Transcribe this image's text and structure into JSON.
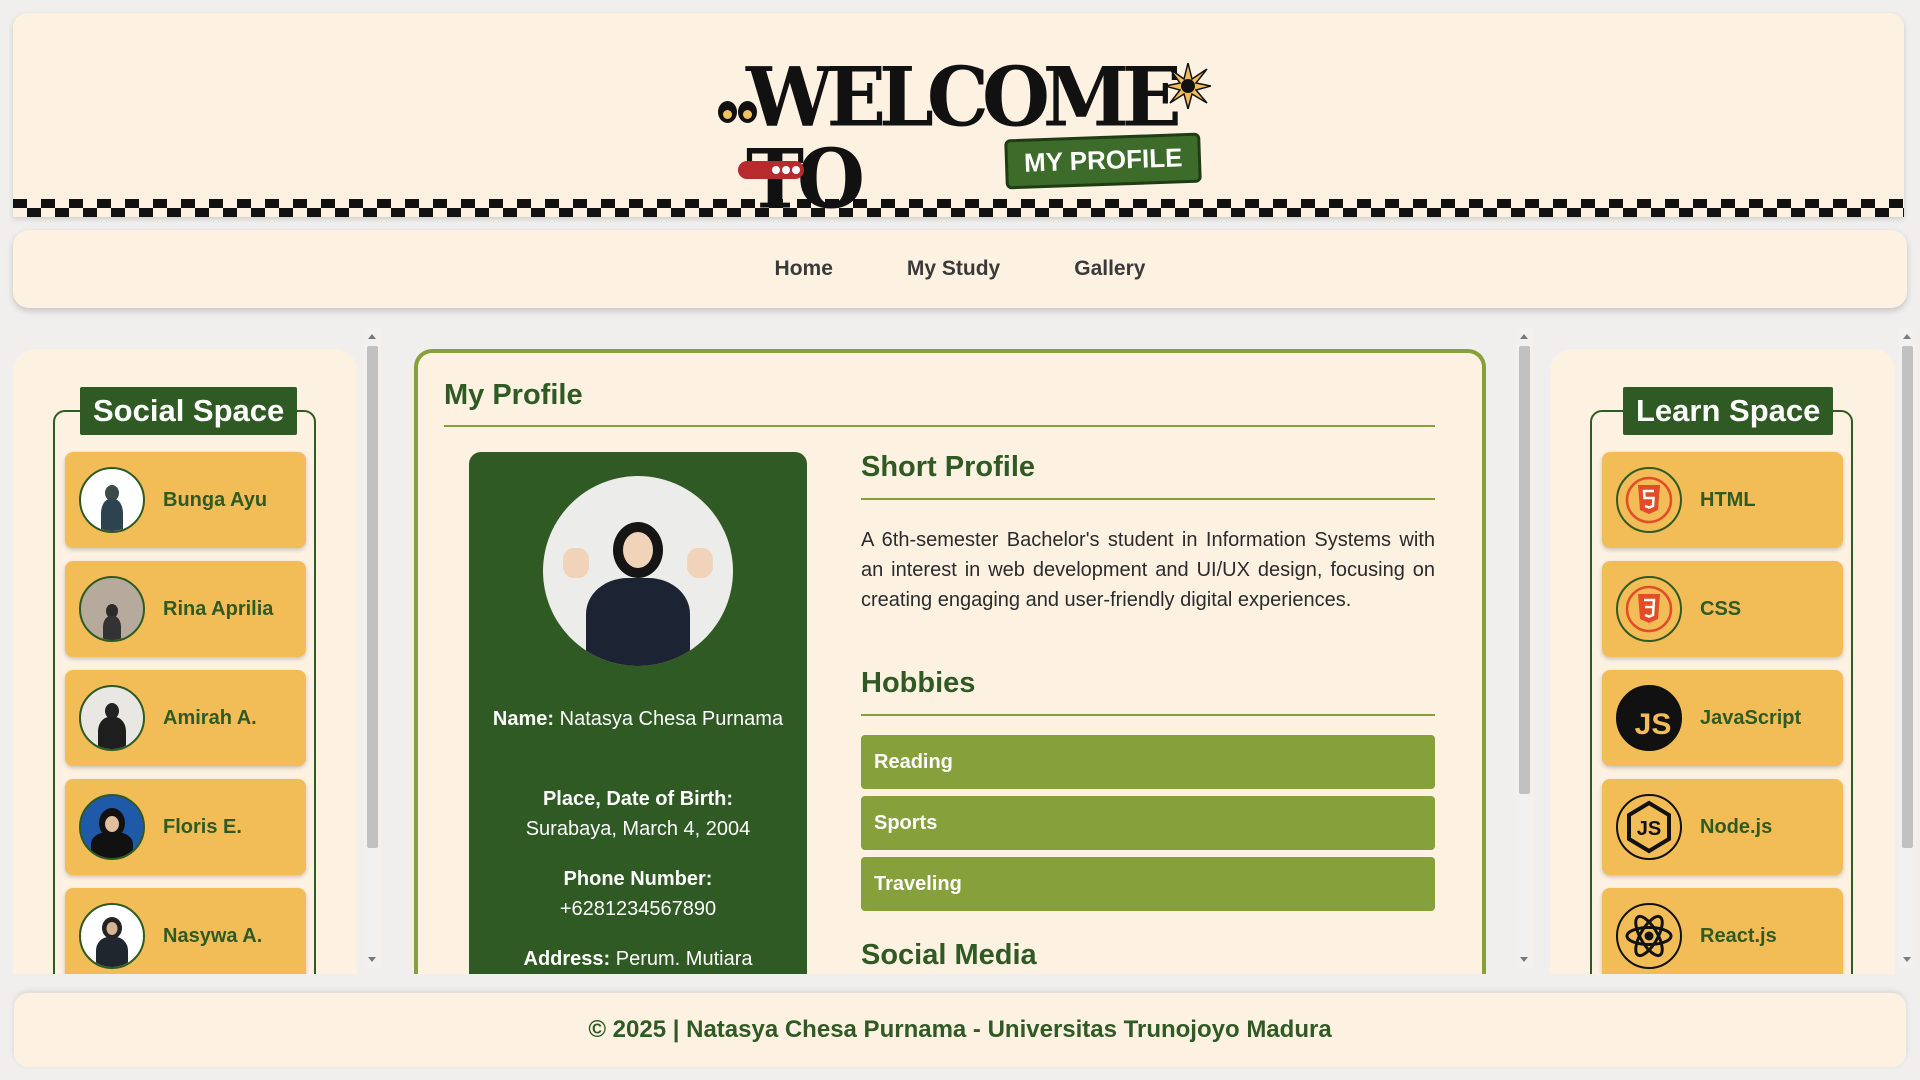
{
  "header": {
    "logo_text": "WELCOME TO",
    "logo_badge": "MY PROFILE"
  },
  "nav": {
    "items": [
      {
        "label": "Home"
      },
      {
        "label": "My Study"
      },
      {
        "label": "Gallery"
      }
    ]
  },
  "social_space": {
    "title": "Social Space",
    "friends": [
      {
        "name": "Bunga Ayu"
      },
      {
        "name": "Rina Aprilia"
      },
      {
        "name": "Amirah A."
      },
      {
        "name": "Floris E."
      },
      {
        "name": "Nasywa A."
      }
    ]
  },
  "learn_space": {
    "title": "Learn Space",
    "items": [
      {
        "name": "HTML",
        "icon": "html5-icon"
      },
      {
        "name": "CSS",
        "icon": "css3-icon"
      },
      {
        "name": "JavaScript",
        "icon": "javascript-icon"
      },
      {
        "name": "Node.js",
        "icon": "nodejs-icon"
      },
      {
        "name": "React.js",
        "icon": "react-icon"
      }
    ]
  },
  "main": {
    "title": "My Profile",
    "profile": {
      "name_label": "Name:",
      "name_value": "Natasya Chesa Purnama",
      "birth_label": "Place, Date of Birth:",
      "birth_value": "Surabaya, March 4, 2004",
      "phone_label": "Phone Number:",
      "phone_value": "+6281234567890",
      "address_label": "Address:",
      "address_value": "Perum. Mutiara"
    },
    "short_profile": {
      "title": "Short Profile",
      "text": "A 6th-semester Bachelor's student in Information Systems with an interest in web development and UI/UX design, focusing on creating engaging and user-friendly digital experiences."
    },
    "hobbies": {
      "title": "Hobbies",
      "items": [
        "Reading",
        "Sports",
        "Traveling"
      ]
    },
    "social_media": {
      "title": "Social Media"
    }
  },
  "footer": {
    "text": "© 2025 | Natasya Chesa Purnama - Universitas Trunojoyo Madura"
  },
  "colors": {
    "cream": "#fdf1e2",
    "dark_green": "#2f5a23",
    "olive_green": "#86a03c",
    "mustard": "#f2bd57"
  }
}
